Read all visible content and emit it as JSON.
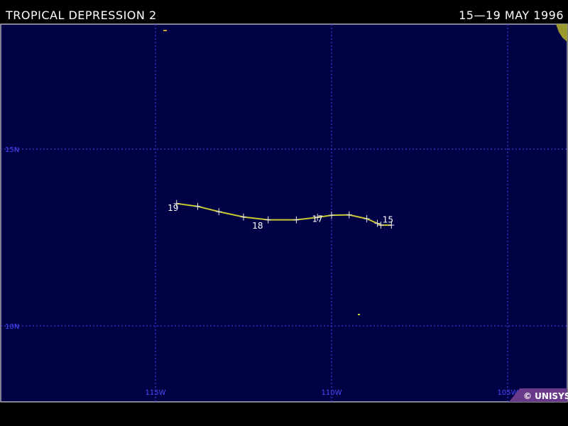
{
  "header": {
    "storm_name": "TROPICAL DEPRESSION 2",
    "date_range": "15—19 MAY 1996"
  },
  "map": {
    "background_color": "#000044",
    "grid_color": "#4a4aff",
    "track_color": "#c8c832",
    "land_color": "#9a9a2e",
    "latitude_labels": [
      {
        "text": "15N",
        "lat": 15
      },
      {
        "text": "10N",
        "lat": 10
      }
    ],
    "longitude_labels": [
      {
        "text": "115W",
        "lon": -115
      },
      {
        "text": "110W",
        "lon": -110
      },
      {
        "text": "105W",
        "lon": -105
      }
    ]
  },
  "track": {
    "points": [
      {
        "lon": -108.3,
        "lat": 12.85
      },
      {
        "lon": -108.6,
        "lat": 12.85
      },
      {
        "lon": -108.7,
        "lat": 12.9
      },
      {
        "lon": -109.0,
        "lat": 13.03
      },
      {
        "lon": -109.5,
        "lat": 13.14
      },
      {
        "lon": -110.0,
        "lat": 13.13
      },
      {
        "lon": -110.4,
        "lat": 13.07
      },
      {
        "lon": -111.0,
        "lat": 13.0
      },
      {
        "lon": -111.8,
        "lat": 13.0
      },
      {
        "lon": -112.5,
        "lat": 13.08
      },
      {
        "lon": -113.2,
        "lat": 13.23
      },
      {
        "lon": -113.8,
        "lat": 13.38
      },
      {
        "lon": -114.4,
        "lat": 13.46
      }
    ],
    "day_labels": [
      {
        "text": "15",
        "lon": -108.4,
        "lat": 13.02
      },
      {
        "text": "17",
        "lon": -110.4,
        "lat": 13.04
      },
      {
        "text": "18",
        "lon": -112.1,
        "lat": 12.85
      },
      {
        "text": "19",
        "lon": -114.5,
        "lat": 13.35
      }
    ]
  },
  "credit": {
    "text": "© UNISYS"
  }
}
